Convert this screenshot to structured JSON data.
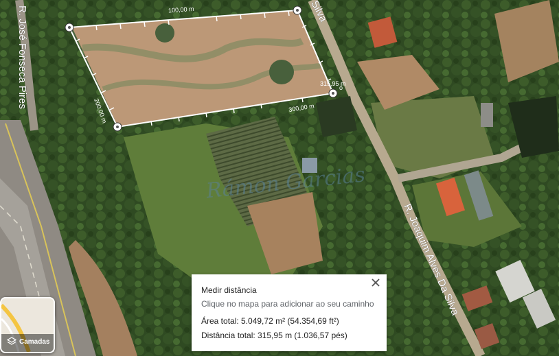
{
  "map": {
    "streets": [
      "R. José Fonseca Pires",
      "Silva",
      "R. Joaquim Alves Da Silva"
    ],
    "measure_labels": [
      "100,00 m",
      "200,00 m",
      "300,00 m",
      "315,95 m"
    ],
    "watermark": "Rámon Garcias"
  },
  "panel": {
    "title": "Medir distância",
    "hint": "Clique no mapa para adicionar ao seu caminho",
    "area": "Área total: 5.049,72 m² (54.354,69 ft²)",
    "distance": "Distância total: 315,95 m (1.036,57 pés)"
  },
  "layers": {
    "label": "Camadas",
    "icon": "layers-icon"
  }
}
